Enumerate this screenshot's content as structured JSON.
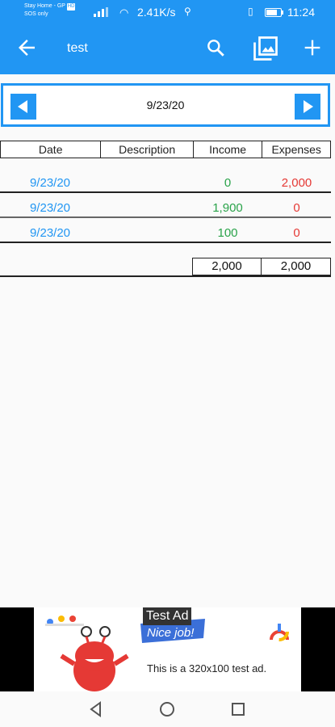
{
  "status_bar": {
    "carrier_line1": "Stay Home - GP",
    "carrier_badge": "HD",
    "carrier_line2": "SOS only",
    "net_speed": "2.41K/s",
    "time": "11:24"
  },
  "toolbar": {
    "title": "test",
    "icons": [
      "back-arrow-icon",
      "search-icon",
      "gallery-icon",
      "add-icon"
    ]
  },
  "date_nav": {
    "date": "9/23/20"
  },
  "table": {
    "headers": [
      "Date",
      "Description",
      "Income",
      "Expenses"
    ],
    "rows": [
      {
        "date": "9/23/20",
        "description": "",
        "income": "0",
        "expenses": "2,000"
      },
      {
        "date": "9/23/20",
        "description": "",
        "income": "1,900",
        "expenses": "0"
      },
      {
        "date": "9/23/20",
        "description": "",
        "income": "100",
        "expenses": "0"
      }
    ],
    "totals": {
      "income": "2,000",
      "expenses": "2,000"
    }
  },
  "ad": {
    "label": "Test Ad",
    "text": "This is a 320x100 test ad.",
    "banner": "Nice job!"
  },
  "colors": {
    "primary": "#2196f3",
    "income": "#2aa34a",
    "expense": "#e53935"
  }
}
